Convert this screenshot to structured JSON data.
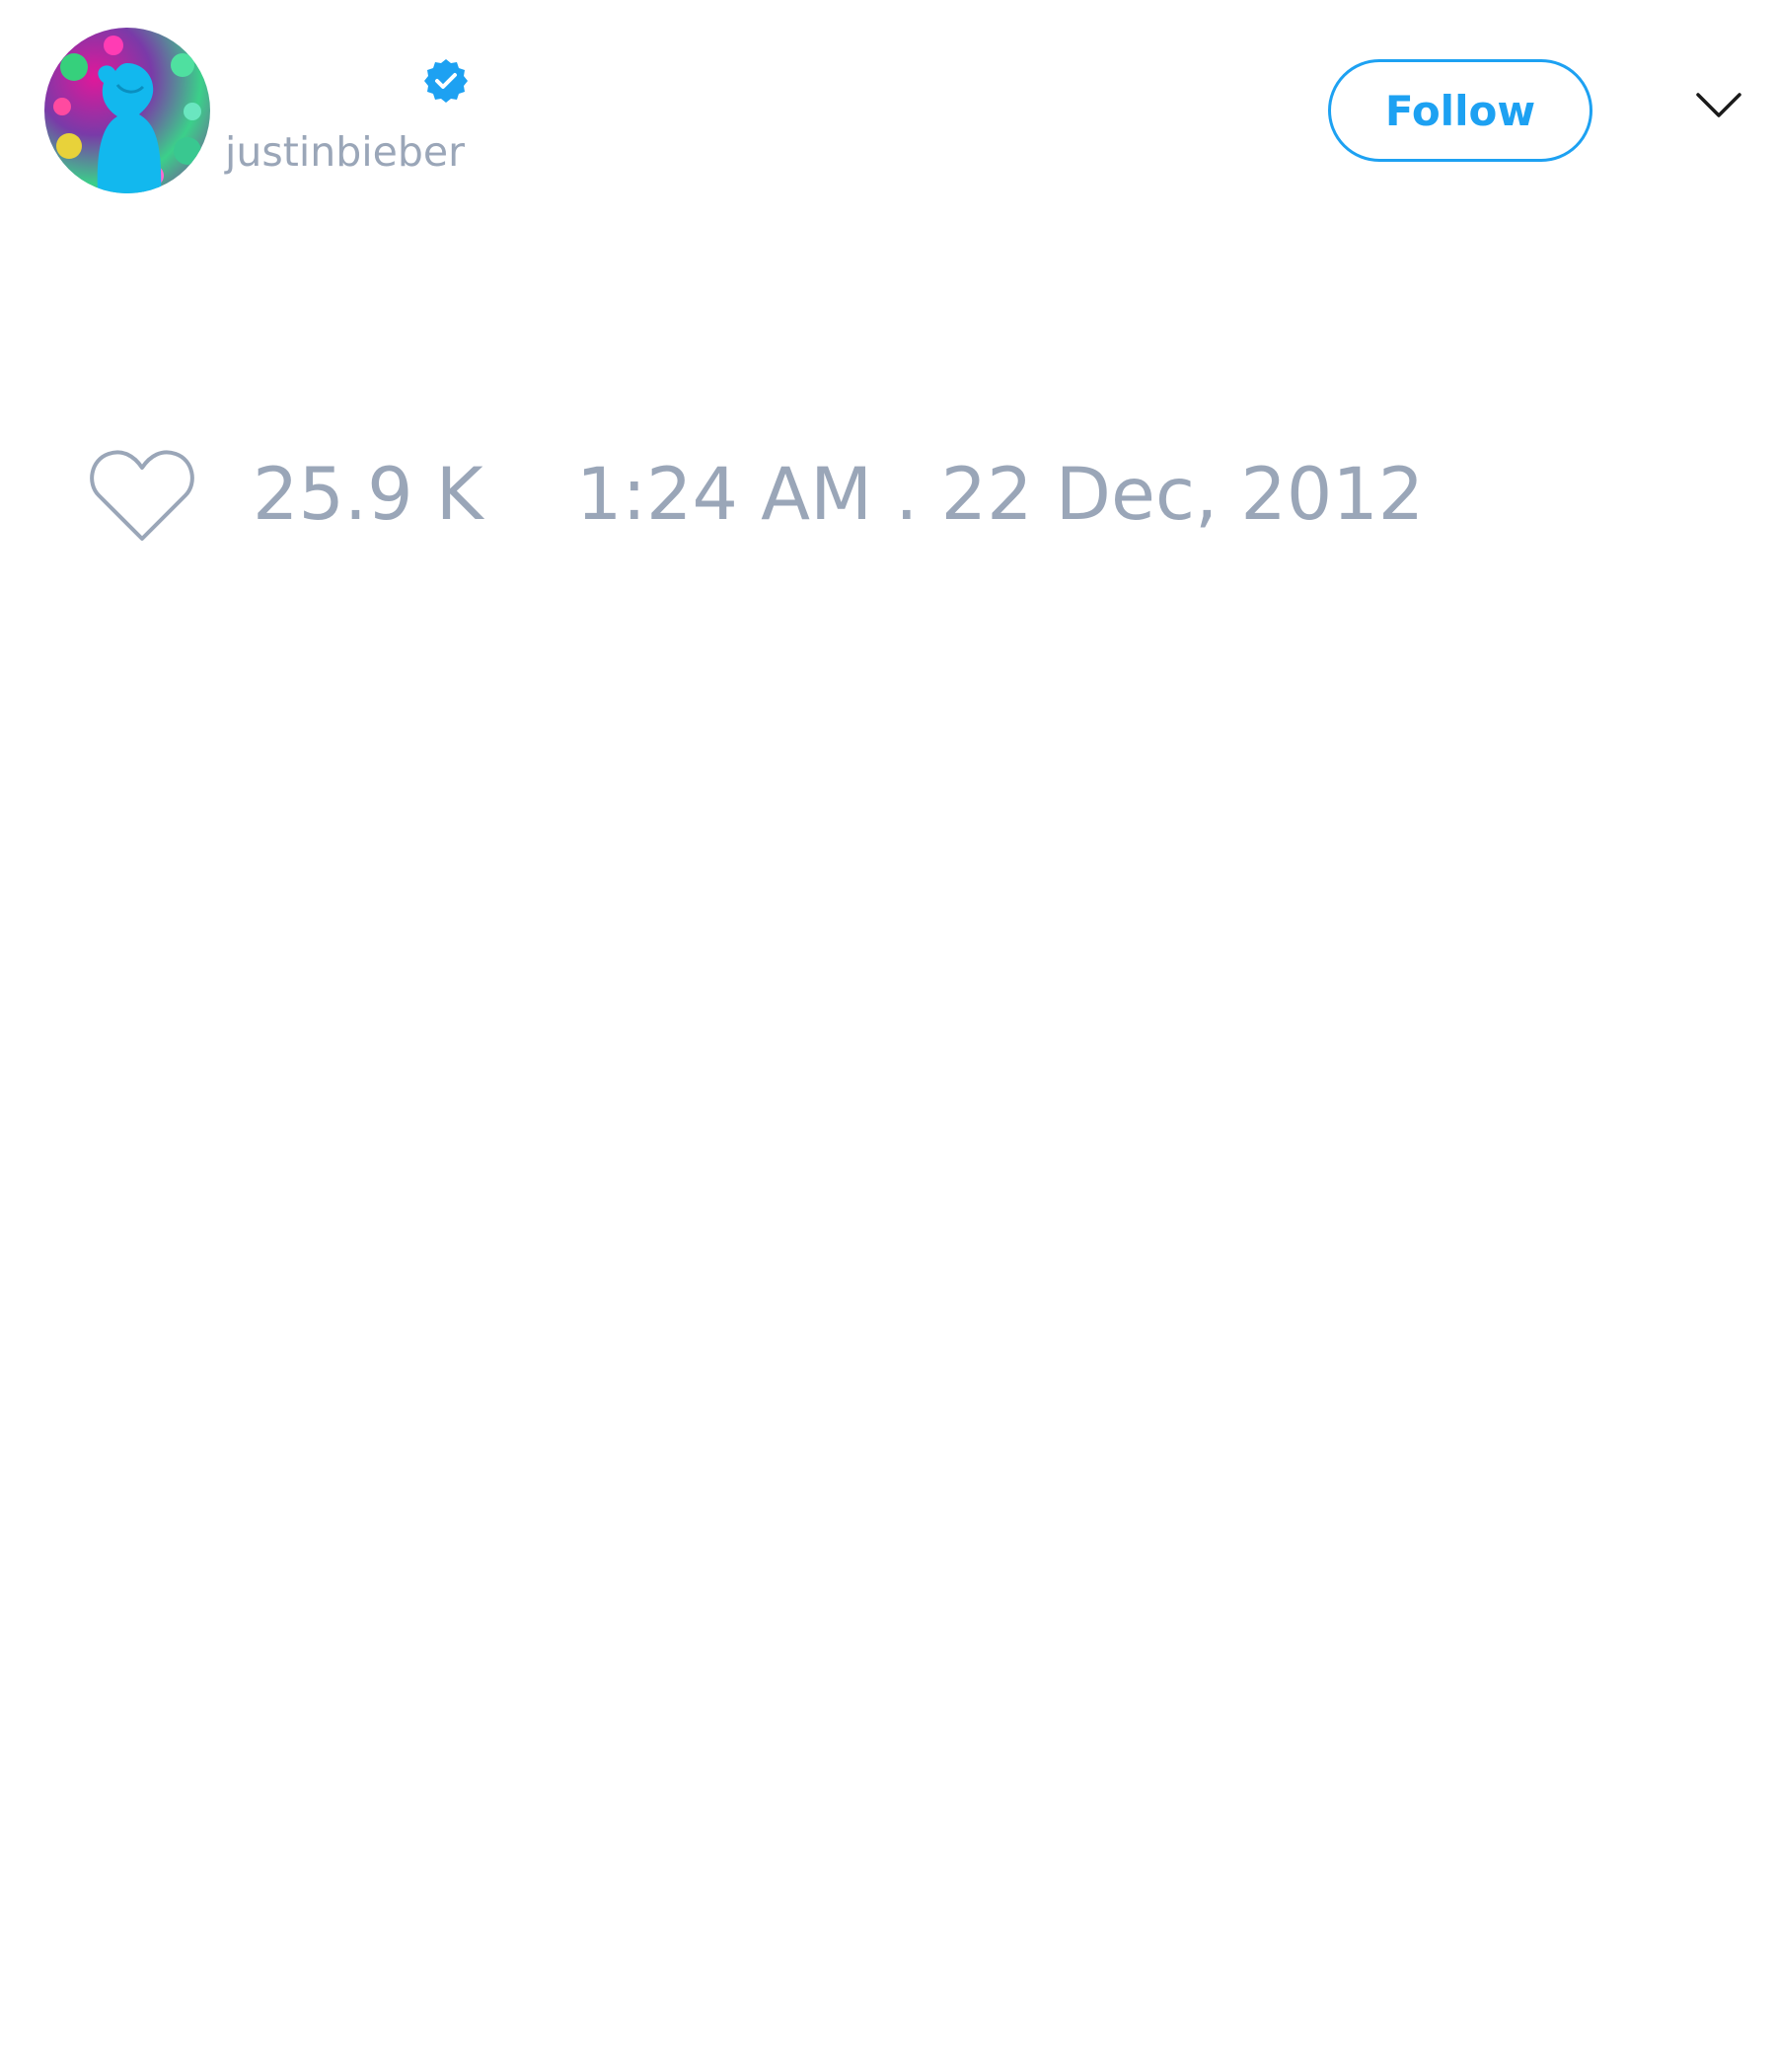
{
  "user": {
    "handle": "justinbieber",
    "verified": true,
    "avatar_icon": "profile-avatar"
  },
  "header": {
    "follow_label": "Follow",
    "menu_icon": "chevron-down-icon"
  },
  "stats": {
    "like_icon": "heart-icon",
    "like_count": "25.9 K",
    "timestamp": "1:24 AM . 22 Dec, 2012"
  },
  "colors": {
    "accent": "#1da1f2",
    "muted_text": "#9aa6b8",
    "background": "#ffffff"
  }
}
